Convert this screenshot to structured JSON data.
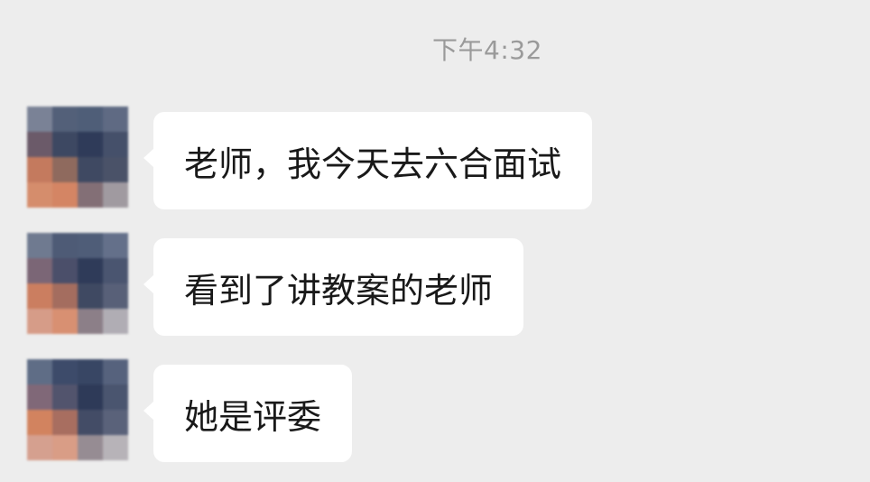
{
  "timestamp": "下午4:32",
  "messages": [
    {
      "text": "老师，我今天去六合面试"
    },
    {
      "text": "看到了讲教案的老师"
    },
    {
      "text": "她是评委"
    }
  ],
  "avatar_icon": "pixelated-avatar-icon",
  "colors": {
    "background": "#ededed",
    "bubble": "#ffffff",
    "text": "#191919",
    "timestamp": "#9a9a9a"
  }
}
